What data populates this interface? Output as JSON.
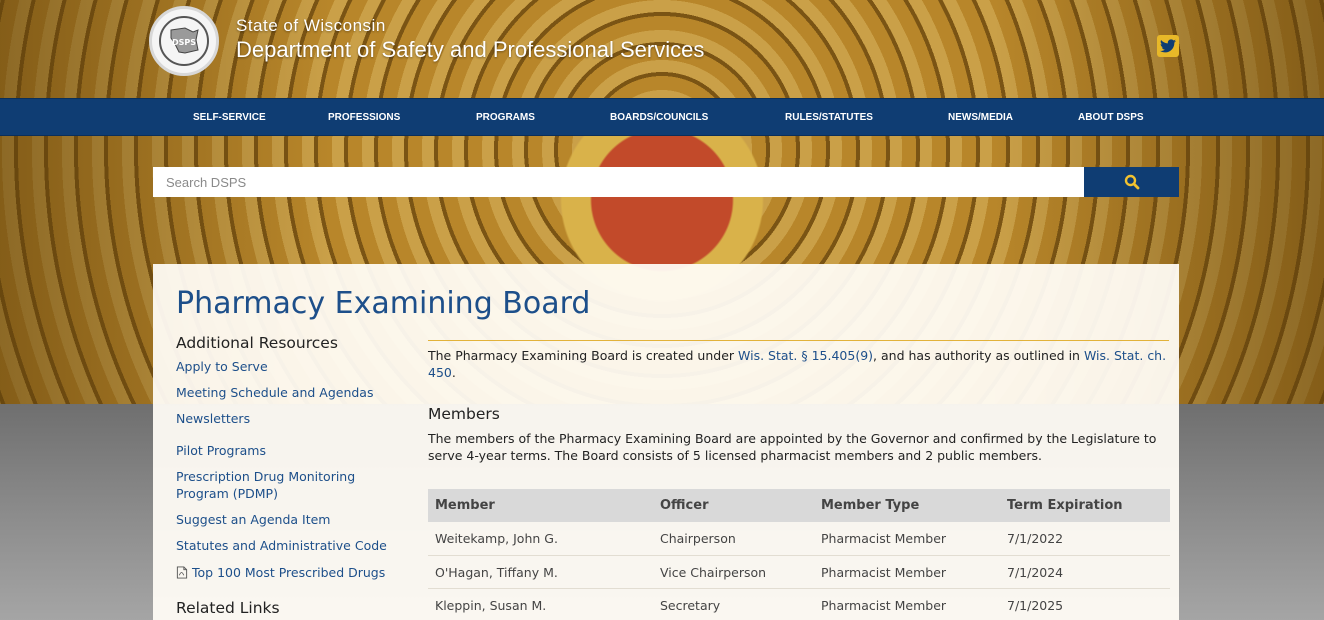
{
  "header": {
    "state": "State of Wisconsin",
    "department": "Department of Safety and Professional Services",
    "logo_text": "DSPS"
  },
  "nav": {
    "items": [
      {
        "label": "SELF-SERVICE"
      },
      {
        "label": "PROFESSIONS"
      },
      {
        "label": "PROGRAMS"
      },
      {
        "label": "BOARDS/COUNCILS"
      },
      {
        "label": "RULES/STATUTES"
      },
      {
        "label": "NEWS/MEDIA"
      },
      {
        "label": "ABOUT DSPS"
      }
    ]
  },
  "search": {
    "placeholder": "Search DSPS",
    "value": ""
  },
  "page": {
    "title": "Pharmacy Examining Board"
  },
  "sidebar": {
    "heading": "Additional Resources",
    "links": [
      {
        "label": "Apply to Serve"
      },
      {
        "label": "Meeting Schedule and Agendas"
      },
      {
        "label": "Newsletters"
      },
      {
        "label": "Pilot Programs"
      },
      {
        "label": "Prescription Drug Monitoring Program (PDMP)"
      },
      {
        "label": "Suggest an Agenda Item"
      },
      {
        "label": "Statutes and Administrative Code"
      },
      {
        "label": "Top 100 Most Prescribed Drugs",
        "icon": "pdf-icon"
      }
    ],
    "related_heading": "Related Links"
  },
  "intro": {
    "part1": "The Pharmacy Examining Board is created under ",
    "link1": "Wis. Stat. § 15.405(9)",
    "part2": ", and has authority as outlined in ",
    "link2": "Wis. Stat. ch. 450",
    "part3": "."
  },
  "members": {
    "heading": "Members",
    "description": "The members of the Pharmacy Examining Board are appointed by the Governor and confirmed by the Legislature to serve 4-year terms. The Board consists of 5 licensed pharmacist members and 2 public members.",
    "columns": [
      "Member",
      "Officer",
      "Member Type",
      "Term Expiration"
    ],
    "rows": [
      [
        "Weitekamp, John G.",
        "Chairperson",
        "Pharmacist Member",
        "7/1/2022"
      ],
      [
        "O'Hagan, Tiffany M.",
        "Vice Chairperson",
        "Pharmacist Member",
        "7/1/2024"
      ],
      [
        "Kleppin, Susan M.",
        "Secretary",
        "Pharmacist Member",
        "7/1/2025"
      ]
    ]
  },
  "colors": {
    "nav_blue": "#0f3d73",
    "link_blue": "#1d4f8a",
    "gold": "#e2b23a",
    "twitter_yellow": "#e8b828"
  }
}
